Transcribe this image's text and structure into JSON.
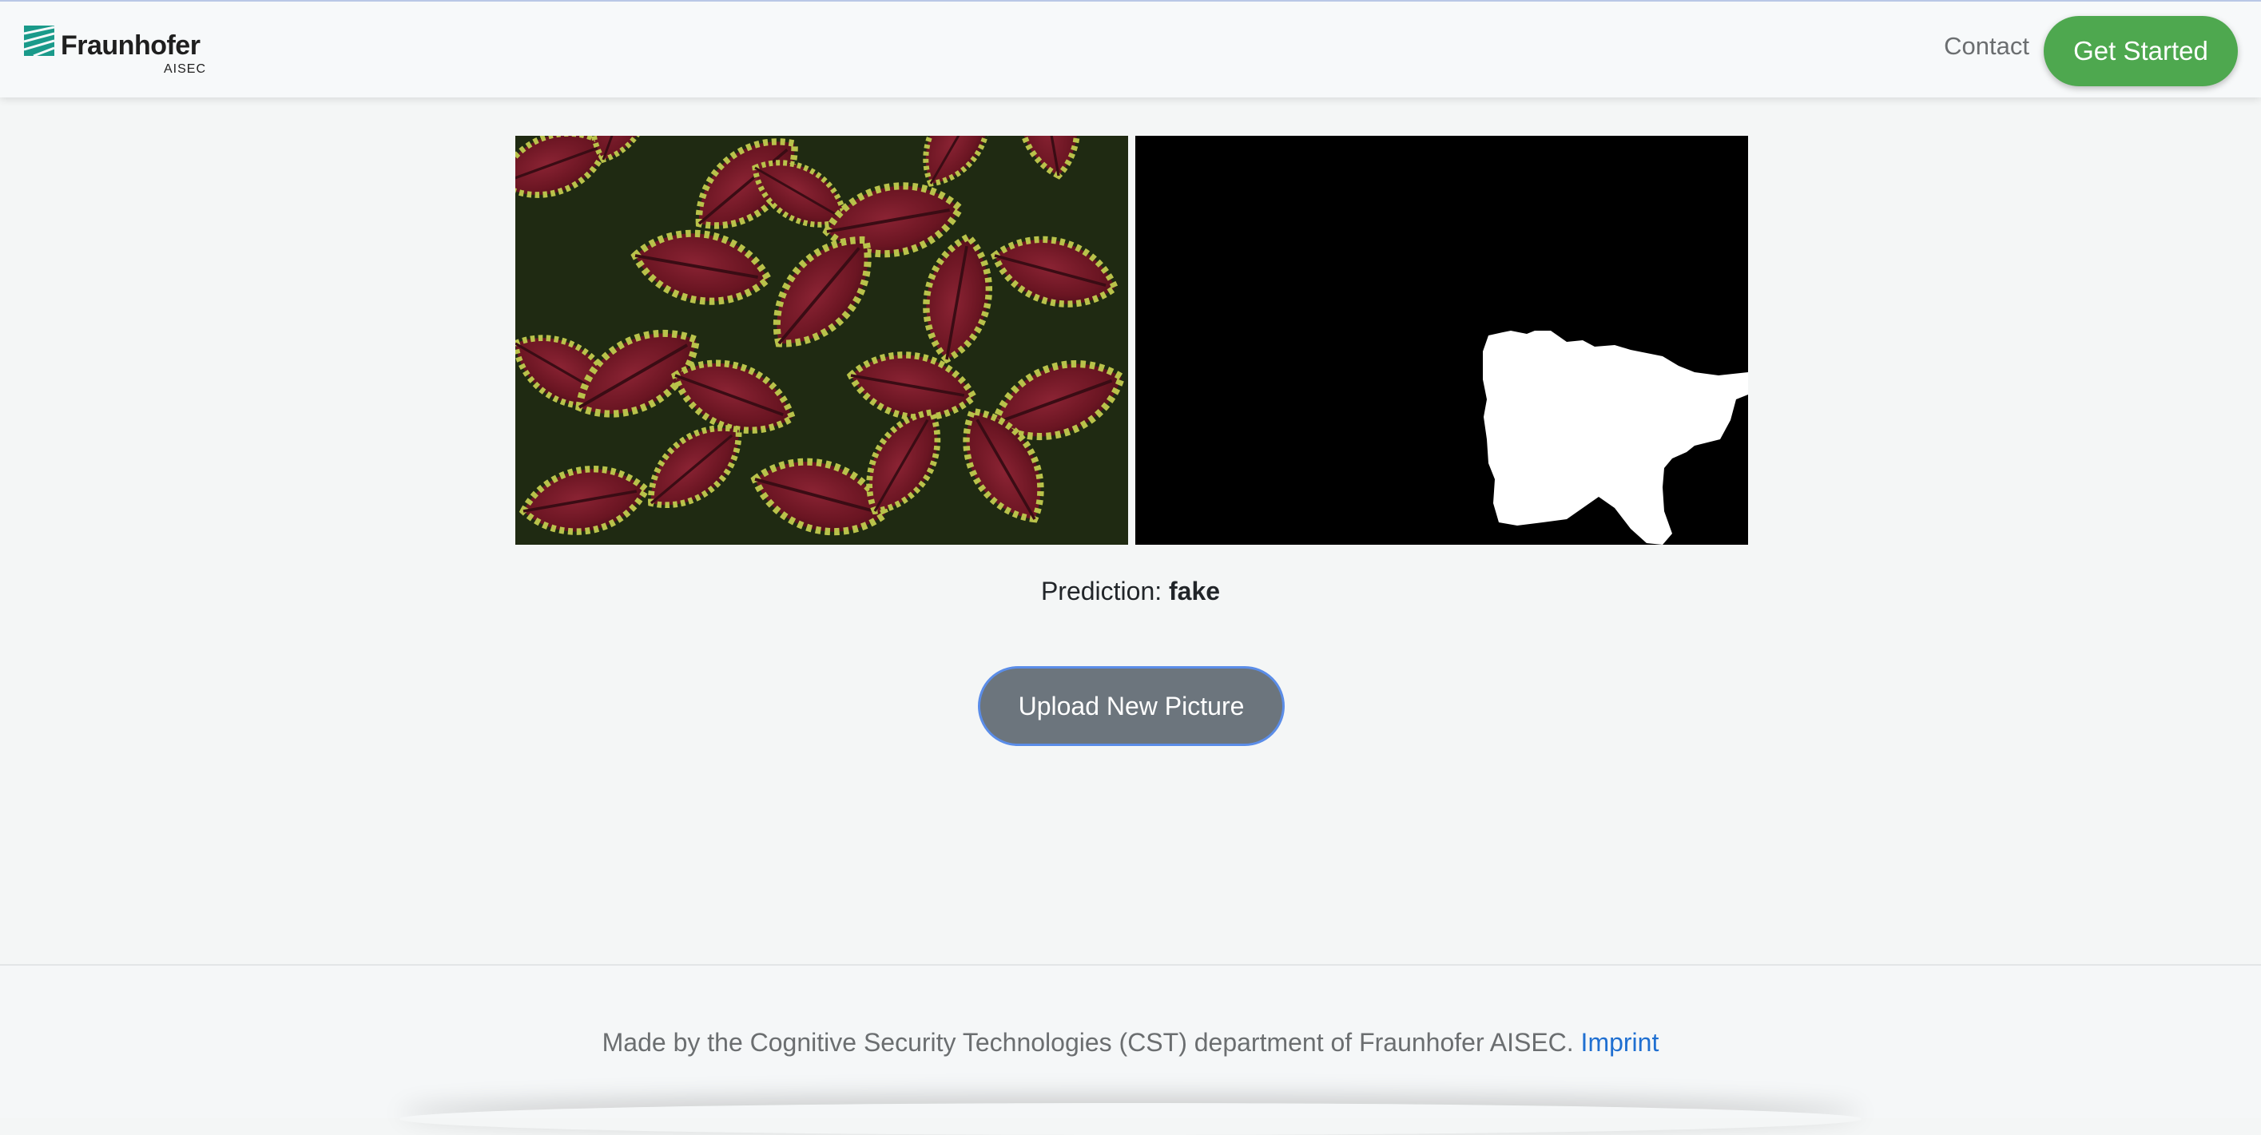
{
  "header": {
    "logo_name": "Fraunhofer",
    "logo_sub": "AISEC",
    "logo_icon": "fraunhofer-logo-icon",
    "nav_contact": "Contact",
    "cta_label": "Get Started"
  },
  "colors": {
    "cta": "#4ea84f",
    "upload_button": "#6c757d",
    "link": "#1f6fd1"
  },
  "result": {
    "prediction_label": "Prediction:",
    "prediction_value": "fake",
    "upload_label": "Upload New Picture"
  },
  "footer": {
    "text": "Made by the Cognitive Security Technologies (CST) department of Fraunhofer AISEC.",
    "link_label": "Imprint"
  }
}
